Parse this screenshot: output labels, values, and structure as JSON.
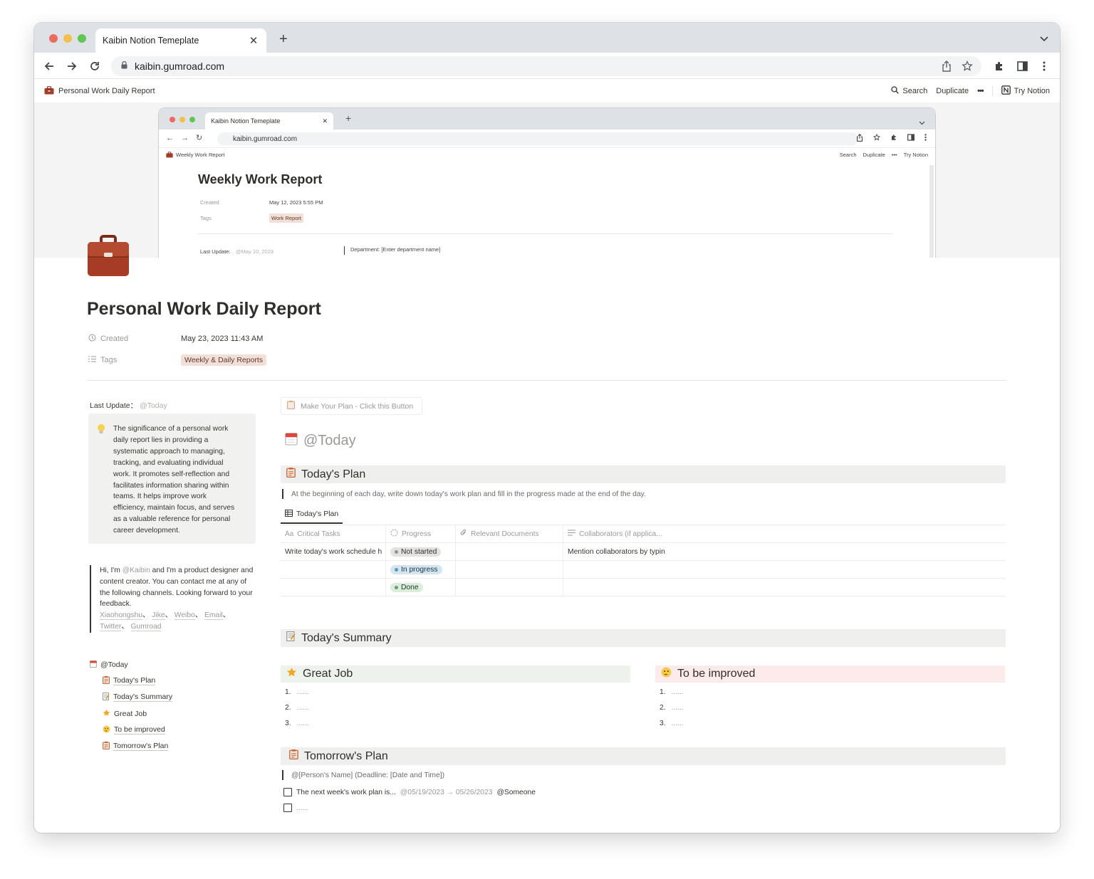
{
  "browser": {
    "tab_title": "Kaibin Notion Temeplate",
    "url": "kaibin.gumroad.com",
    "colors": {
      "close": "#ed6a5e",
      "minimize": "#f5bf4f",
      "zoom": "#61c554"
    }
  },
  "notion_topbar": {
    "breadcrumb": "Personal Work Daily Report",
    "search": "Search",
    "duplicate": "Duplicate",
    "more": "•••",
    "try_notion": "Try Notion"
  },
  "cover_preview": {
    "tab_title": "Kaibin Notion Temeplate",
    "url": "kaibin.gumroad.com",
    "breadcrumb": "Weekly Work Report",
    "search": "Search",
    "duplicate": "Duplicate",
    "try_notion": "Try Notion",
    "title": "Weekly Work Report",
    "created_label": "Created",
    "created_value": "May 12, 2023 5:55 PM",
    "tags_label": "Tags",
    "tags_value": "Work Report",
    "last_update_label": "Last Update:",
    "last_update_value": "@May 10, 2023",
    "department": "Department: [Enter department name]"
  },
  "page": {
    "icon": "briefcase-icon",
    "title": "Personal Work Daily Report",
    "created_label": "Created",
    "created_value": "May 23, 2023 11:43 AM",
    "tags_label": "Tags",
    "tag": "Weekly & Daily Reports"
  },
  "sidebar": {
    "last_update_label": "Last Update：",
    "last_update_value": "@Today",
    "callout": "The significance of a personal work daily report lies in providing a systematic approach to managing, tracking, and evaluating individual work. It promotes self-reflection and facilitates information sharing within teams. It helps improve work efficiency, maintain focus, and serves as a valuable reference for personal career development.",
    "quote_prefix": "Hi, I'm ",
    "quote_mention": "@Kaibin",
    "quote_suffix": " and I'm a product designer and content creator. You can contact me at any of the following channels. Looking forward to your feedback.",
    "channels": [
      "Xiaohongshu",
      "Jike",
      "Weibo",
      "Email",
      "Twitter",
      "Gumroad"
    ],
    "toc": [
      {
        "label": "@Today",
        "icon": "calendar-icon",
        "sub": false
      },
      {
        "label": "Today's Plan",
        "icon": "clipboard-icon",
        "sub": true
      },
      {
        "label": "Today's Summary",
        "icon": "memo-icon",
        "sub": true
      },
      {
        "label": "Great Job",
        "icon": "star-icon",
        "sub": true
      },
      {
        "label": "To be improved",
        "icon": "thinking-face-icon",
        "sub": true
      },
      {
        "label": "Tomorrow's Plan",
        "icon": "clipboard-icon",
        "sub": true
      }
    ]
  },
  "main": {
    "plan_button": "Make Your Plan - Click this Button",
    "today_heading": "@Today",
    "todays_plan": {
      "heading": "Today's Plan",
      "note": "At the beginning of each day, write down today's work plan and fill in the progress made at the end of the day.",
      "view_tab": "Today's Plan",
      "columns": [
        "Critical Tasks",
        "Progress",
        "Relevant Documents",
        "Collaborators (if applica..."
      ],
      "rows": [
        {
          "task": "Write today's work schedule h",
          "status": "Not started",
          "docs": "",
          "collab": "Mention collaborators by typin"
        },
        {
          "task": "",
          "status": "In progress",
          "docs": "",
          "collab": ""
        },
        {
          "task": "",
          "status": "Done",
          "docs": "",
          "collab": ""
        }
      ]
    },
    "todays_summary": {
      "heading": "Today's Summary"
    },
    "great_job": {
      "heading": "Great Job",
      "items": [
        "......",
        "......",
        "......"
      ]
    },
    "to_be_improved": {
      "heading": "To be improved",
      "items": [
        "......",
        "......",
        "......"
      ]
    },
    "tomorrows_plan": {
      "heading": "Tomorrow's Plan",
      "note": "@[Person's Name] (Deadline: [Date and Time])",
      "todo1_text": "The next week's work plan is...",
      "todo1_date": "@05/19/2023 → 05/26/2023",
      "todo1_person": "@Someone",
      "todo2_text": "......"
    },
    "colors": {
      "section_bg": "#efefed",
      "great_job_bg": "#edf3ec",
      "improve_bg": "#fdebec",
      "not_started_bg": "#e3e2e0",
      "in_progress_bg": "#d3e5ef",
      "done_bg": "#dbeddb"
    }
  }
}
